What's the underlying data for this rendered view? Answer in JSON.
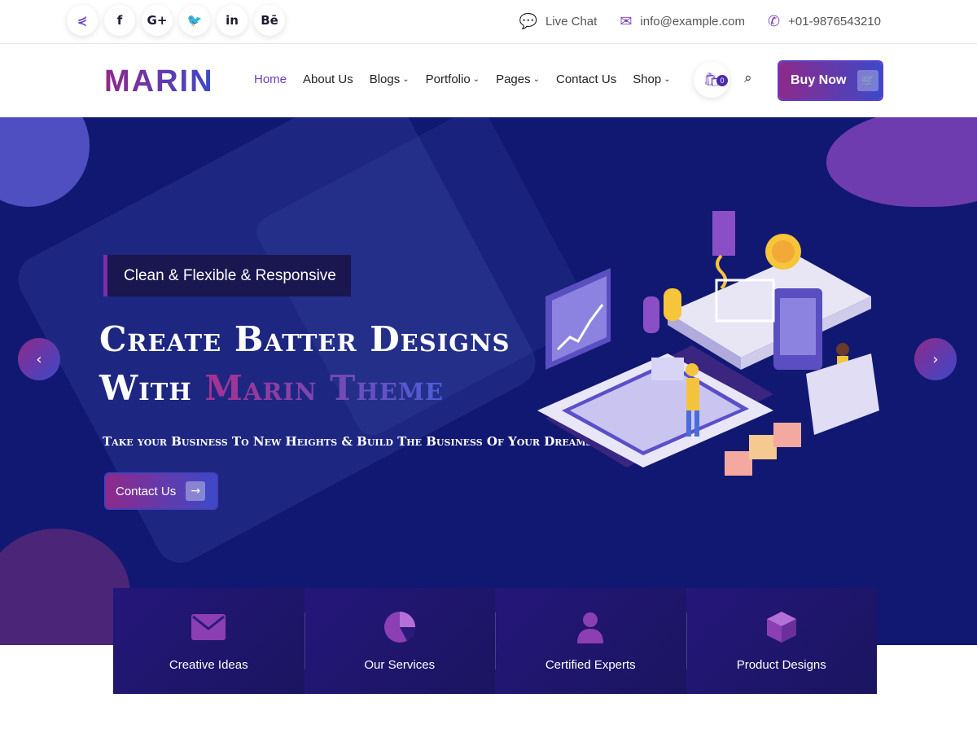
{
  "topbar": {
    "social_icons": [
      {
        "name": "share-icon",
        "glyph": "<"
      },
      {
        "name": "facebook-icon",
        "glyph": "f"
      },
      {
        "name": "google-plus-icon",
        "glyph": "G+"
      },
      {
        "name": "twitter-icon",
        "glyph": "t"
      },
      {
        "name": "linkedin-icon",
        "glyph": "in"
      },
      {
        "name": "behance-icon",
        "glyph": "Bē"
      }
    ],
    "live_chat": "Live Chat",
    "email": "info@example.com",
    "phone": "+01-9876543210"
  },
  "nav": {
    "logo": "MARIN",
    "items": [
      {
        "label": "Home",
        "active": true
      },
      {
        "label": "About Us"
      },
      {
        "label": "Blogs",
        "dropdown": true
      },
      {
        "label": "Portfolio",
        "dropdown": true
      },
      {
        "label": "Pages",
        "dropdown": true
      },
      {
        "label": "Contact Us"
      },
      {
        "label": "Shop",
        "dropdown": true
      }
    ],
    "cart_count": "0",
    "buy_now": "Buy Now"
  },
  "hero": {
    "tagline": "Clean & Flexible & Responsive",
    "heading_line1": "Create Batter Designs",
    "heading_line2_prefix": "With ",
    "heading_line2_highlight": "Marin Theme",
    "subheading": "Take your Business To New Heights & Build The Business Of Your Dreams",
    "cta_label": "Contact Us"
  },
  "features": [
    {
      "label": "Creative Ideas",
      "icon": "envelope-icon"
    },
    {
      "label": "Our Services",
      "icon": "pie-chart-icon"
    },
    {
      "label": "Certified Experts",
      "icon": "user-icon"
    },
    {
      "label": "Product Designs",
      "icon": "cube-icon"
    }
  ],
  "colors": {
    "accent_purple": "#8e2a8a",
    "accent_blue": "#3c49c9",
    "hero_bg": "#111872"
  }
}
